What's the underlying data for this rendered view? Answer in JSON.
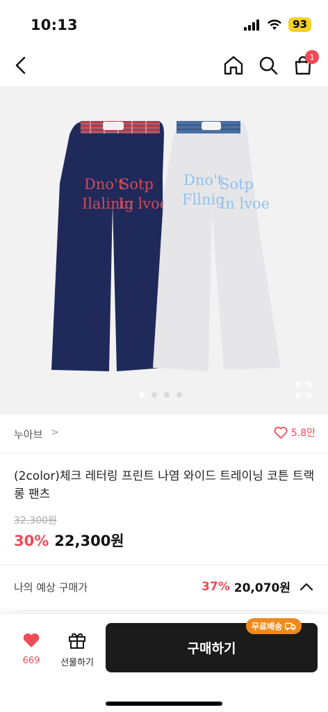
{
  "status_bar": {
    "time": "10:13",
    "battery": "93"
  },
  "nav": {
    "cart_count": "1"
  },
  "gallery": {
    "dot_count": 4,
    "active_dot": 0,
    "navy_letters": [
      "Dno't",
      "Sotp",
      "Ilalinig",
      "In lvoe"
    ],
    "white_letters": [
      "Dno't",
      "Sotp",
      "Fllnig",
      "In lvoe"
    ]
  },
  "brand": {
    "name": "누아브",
    "chevron": ">",
    "likes": "5.8만"
  },
  "product": {
    "title": "(2color)체크 레터링 프린트 나염 와이드 트레이닝 코튼 트랙 롱 팬츠",
    "original_price": "32,300원",
    "discount": "30%",
    "price": "22,300원"
  },
  "expected": {
    "label": "나의 예상 구매가",
    "discount": "37%",
    "price": "20,070원"
  },
  "bottom": {
    "like_count": "669",
    "gift_label": "선물하기",
    "buy_label": "구매하기",
    "free_shipping": "무료배송"
  },
  "colors": {
    "accent": "#ef4a56",
    "buy_button": "#1b1b1b",
    "free_shipping": "#f08a1f",
    "battery": "#f4d11f"
  }
}
